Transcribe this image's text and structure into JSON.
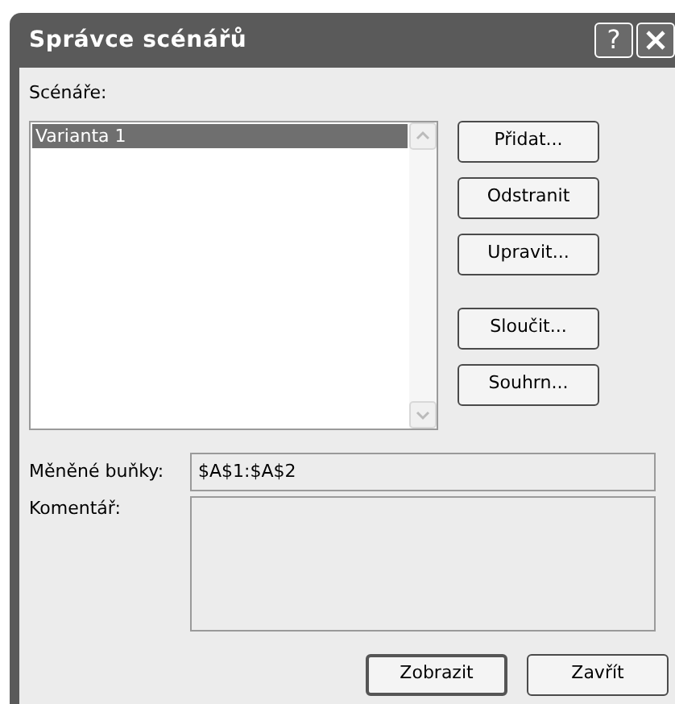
{
  "window": {
    "title": "Správce scénářů",
    "help_button": "?"
  },
  "scenarios": {
    "label": "Scénáře:",
    "items": [
      {
        "name": "Varianta 1",
        "selected": true
      }
    ]
  },
  "side_button_groups": [
    {
      "buttons": [
        {
          "label": "Přidat..."
        },
        {
          "label": "Odstranit"
        },
        {
          "label": "Upravit..."
        }
      ]
    },
    {
      "buttons": [
        {
          "label": "Sloučit..."
        },
        {
          "label": "Souhrn..."
        }
      ]
    }
  ],
  "changing_cells": {
    "label": "Měněné buňky:",
    "value": "$A$1:$A$2"
  },
  "comment": {
    "label": "Komentář:"
  },
  "buttons": [
    {
      "label": "Zobrazit",
      "default": true
    },
    {
      "label": "Zavřít",
      "default": false
    }
  ]
}
